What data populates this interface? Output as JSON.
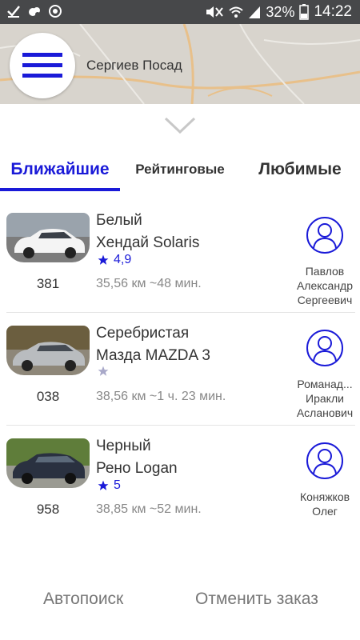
{
  "status_bar": {
    "battery": "32%",
    "time": "14:22",
    "icons": [
      "check-icon",
      "cloud-icon",
      "sync-icon",
      "mute-icon",
      "wifi-icon",
      "signal-icon",
      "battery-icon"
    ]
  },
  "map": {
    "city": "Сергиев Посад"
  },
  "tabs": [
    {
      "label": "Ближайшие",
      "active": true
    },
    {
      "label": "Рейтинговые",
      "active": false
    },
    {
      "label": "Любимые",
      "active": false
    }
  ],
  "cars": [
    {
      "color_name": "Белый",
      "model": "Хендай Solaris",
      "rating": "4,9",
      "plate": "381",
      "distance": "35,56 км  ~48 мин.",
      "driver": [
        "Павлов",
        "Александр",
        "Сергеевич"
      ],
      "car_color": "#f4f4f4"
    },
    {
      "color_name": "Серебристая",
      "model": "Мазда MAZDA 3",
      "rating": "",
      "plate": "038",
      "distance": "38,56 км  ~1 ч. 23 мин.",
      "driver": [
        "Романад...",
        "Иракли",
        "Асланович"
      ],
      "car_color": "#b9bcbf"
    },
    {
      "color_name": "Черный",
      "model": "Рено Logan",
      "rating": "5",
      "plate": "958",
      "distance": "38,85 км  ~52 мин.",
      "driver": [
        "Коняжков",
        "Олег",
        ""
      ],
      "car_color": "#2a3140"
    }
  ],
  "buttons": {
    "auto_search": "Автопоиск",
    "cancel_order": "Отменить заказ"
  },
  "colors": {
    "accent": "#1a1ad8",
    "status_bar": "#47484a",
    "map": "#d8d4cd"
  }
}
